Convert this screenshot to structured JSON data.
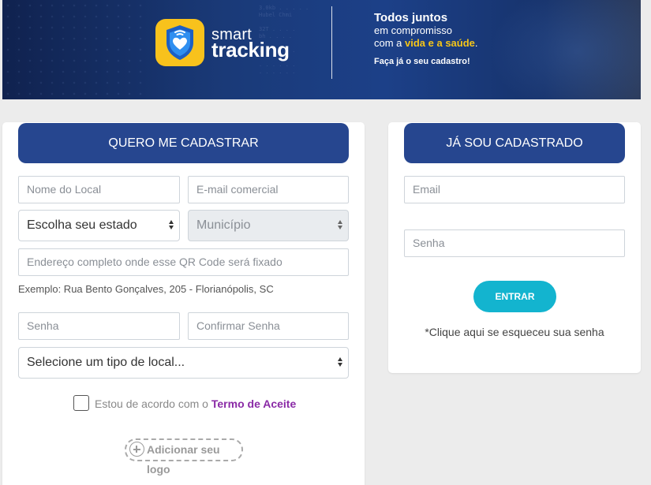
{
  "banner": {
    "logo_line1": "smart",
    "logo_line2": "tracking",
    "tagline_title": "Todos juntos",
    "tagline_line2": "em compromisso",
    "tagline_line3_prefix": "com a ",
    "tagline_line3_highlight": "vida e a saúde",
    "tagline_line3_suffix": ".",
    "tagline_cta": "Faça já o seu cadastro!",
    "highlight_color": "#f5c518"
  },
  "register": {
    "header": "QUERO ME CADASTRAR",
    "place_name_placeholder": "Nome do Local",
    "business_email_placeholder": "E-mail comercial",
    "state_select_value": "Escolha seu estado",
    "city_select_value": "Município",
    "address_placeholder": "Endereço completo onde esse QR Code será fixado",
    "address_hint": "Exemplo: Rua Bento Gonçalves, 205 - Florianópolis, SC",
    "password_placeholder": "Senha",
    "confirm_password_placeholder": "Confirmar Senha",
    "place_type_select_value": "Selecione um tipo de local...",
    "agree_text": "Estou de acordo com o ",
    "agree_link": "Termo de Aceite",
    "add_logo_label": "Adicionar seu logo"
  },
  "login": {
    "header": "JÁ SOU CADASTRADO",
    "email_placeholder": "Email",
    "password_placeholder": "Senha",
    "enter_button": "ENTRAR",
    "forgot_text": "*Clique aqui se esqueceu sua senha"
  },
  "colors": {
    "header_blue": "#26468f",
    "enter_button": "#13b4cf",
    "term_link": "#8a2aa6"
  },
  "icons": [
    "shield-heart-logo-icon",
    "plus-circle-icon",
    "select-arrows-icon"
  ]
}
